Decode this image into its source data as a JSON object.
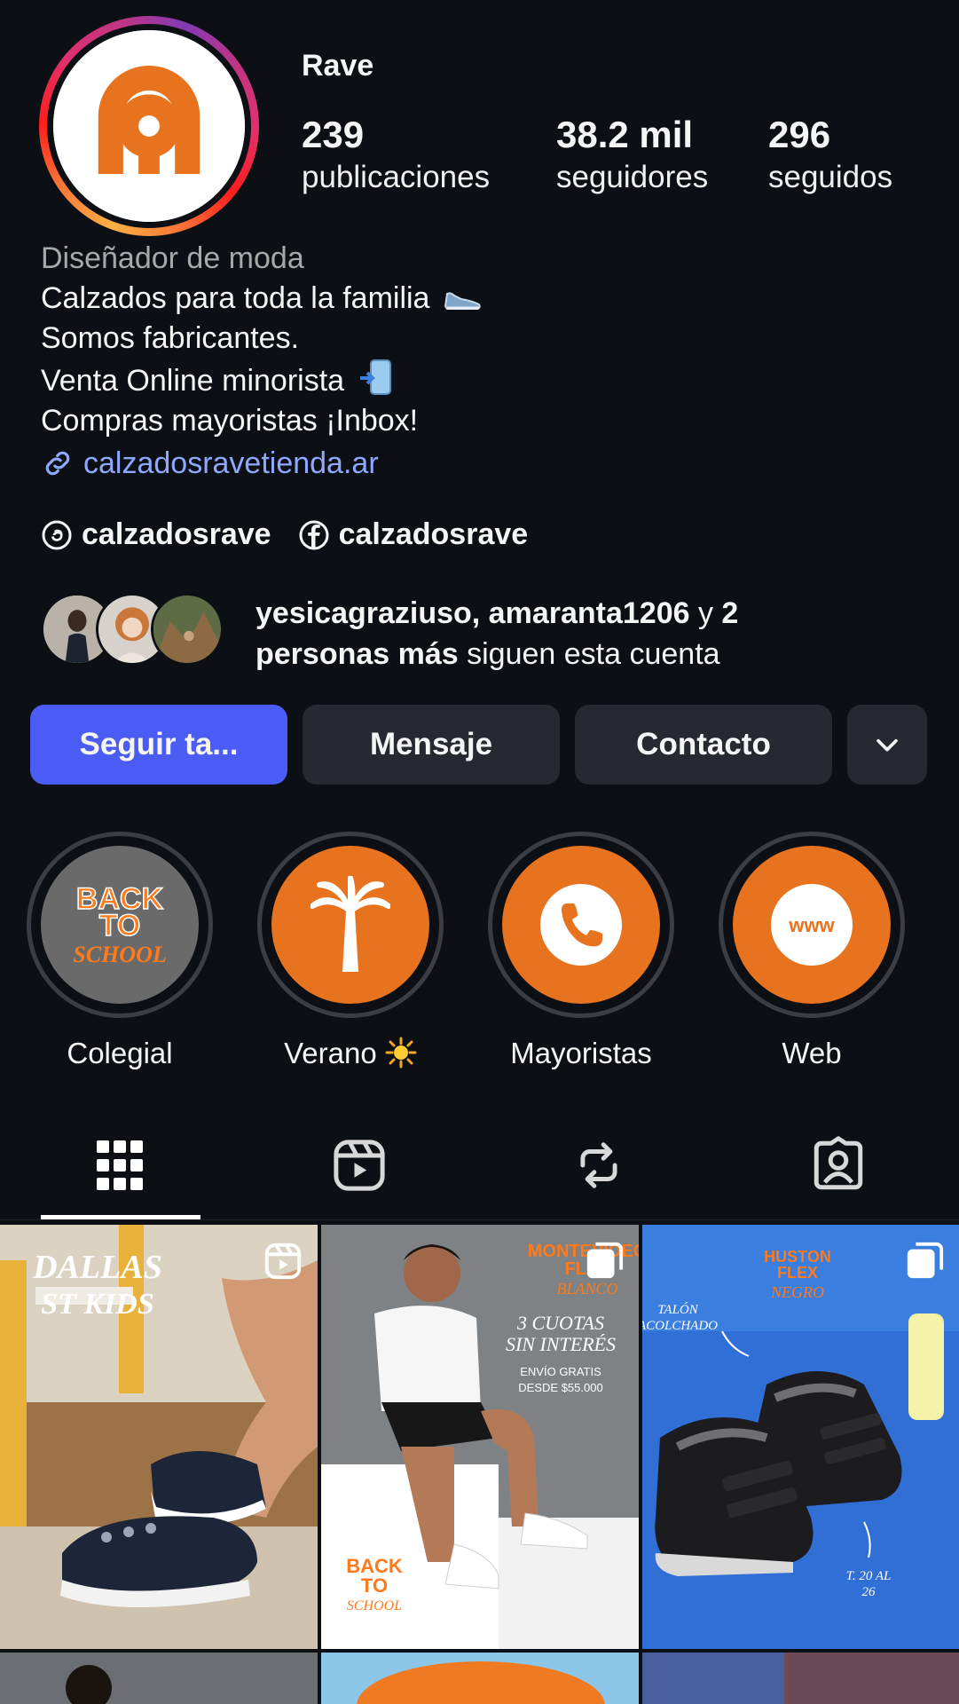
{
  "profile": {
    "username": "Rave",
    "stats": [
      {
        "value": "239",
        "label": "publicaciones"
      },
      {
        "value": "38.2 mil",
        "label": "seguidores"
      },
      {
        "value": "296",
        "label": "seguidos"
      }
    ]
  },
  "bio": {
    "category": "Diseñador de moda",
    "lines": [
      "Calzados para toda la familia",
      "Somos fabricantes.",
      "Venta Online minorista",
      "Compras mayoristas ¡Inbox!"
    ],
    "line_icons": [
      "shoe-emoji-icon",
      "",
      "phone-arrow-emoji-icon",
      ""
    ],
    "link": "calzadosravetienda.ar"
  },
  "social": [
    {
      "icon": "threads-icon",
      "handle": "calzadosrave"
    },
    {
      "icon": "facebook-icon",
      "handle": "calzadosrave"
    }
  ],
  "followed_by": {
    "names": "yesicagraziuso, amaranta1206",
    "connector": " y ",
    "count": "2",
    "others": "personas más",
    "suffix": " siguen esta cuenta"
  },
  "actions": {
    "follow": "Seguir ta...",
    "message": "Mensaje",
    "contact": "Contacto",
    "more_icon": "chevron-down-icon"
  },
  "highlights": [
    {
      "label": "Colegial",
      "cover_text": [
        "BACK",
        "TO",
        "SCHOOL"
      ]
    },
    {
      "label": "Verano",
      "icon": "palm-tree-icon",
      "emoji_icon": "sun-emoji-icon"
    },
    {
      "label": "Mayoristas",
      "icon": "phone-icon"
    },
    {
      "label": "Web",
      "icon": "www-icon",
      "icon_text": "www"
    }
  ],
  "tabs": [
    {
      "name": "posts-grid",
      "icon": "grid-icon",
      "active": true
    },
    {
      "name": "reels",
      "icon": "reels-icon",
      "active": false
    },
    {
      "name": "reposts",
      "icon": "repost-icon",
      "active": false
    },
    {
      "name": "tagged",
      "icon": "tagged-person-icon",
      "active": false
    }
  ],
  "posts": [
    {
      "type": "reel",
      "text": [
        "DALLAS",
        "ST KIDS"
      ]
    },
    {
      "type": "carousel",
      "text": [
        "MONTEVIDEO",
        "FLEX",
        "BLANCO",
        "3 CUOTAS",
        "SIN INTERÉS",
        "ENVÍO GRATIS",
        "DESDE $55.000",
        "BACK",
        "TO",
        "SCHOOL"
      ]
    },
    {
      "type": "carousel",
      "text": [
        "HUSTON",
        "FLEX",
        "NEGRO",
        "TALÓN",
        "ACOLCHADO",
        "T. 20 AL",
        "26"
      ]
    }
  ],
  "colors": {
    "background": "#0c0f14",
    "primary_button": "#4b5cf5",
    "secondary_button": "#262a30",
    "brand_orange": "#e8731e",
    "link": "#8fa8ff",
    "muted": "#a8a8a8"
  }
}
